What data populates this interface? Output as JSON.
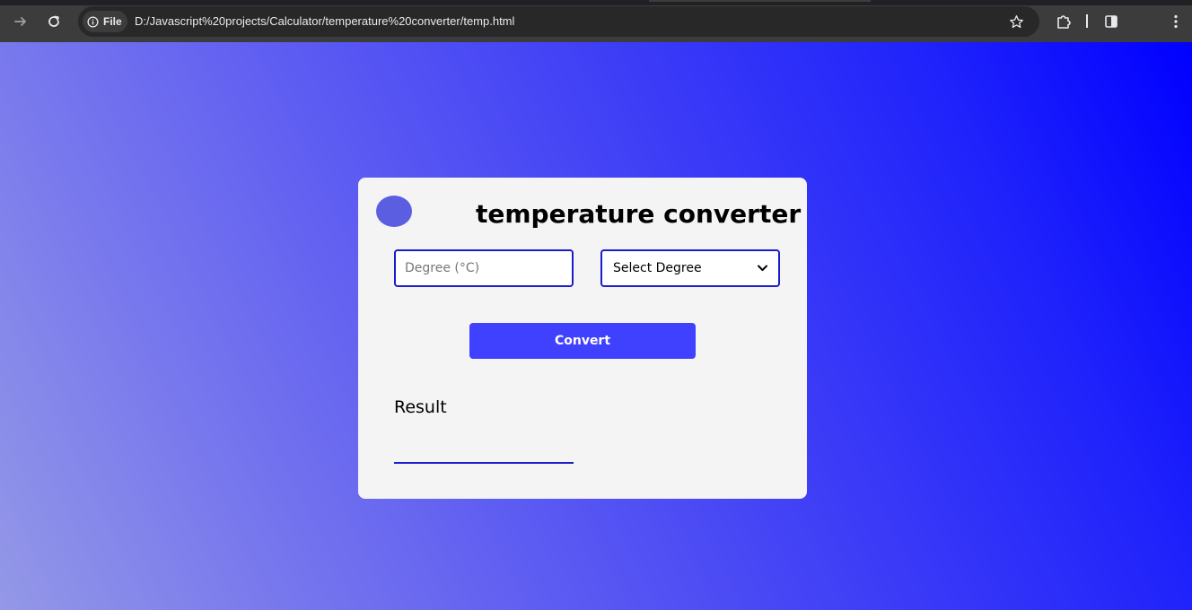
{
  "browser": {
    "site_chip_label": "File",
    "url": "D:/Javascript%20projects/Calculator/temperature%20converter/temp.html",
    "icons": [
      "forward-icon",
      "reload-icon",
      "info-icon",
      "star-icon",
      "extensions-icon",
      "side-panel-icon",
      "menu-icon"
    ]
  },
  "page": {
    "title": "temperature converter",
    "degree_input": {
      "placeholder": "Degree (°C)",
      "value": ""
    },
    "degree_select": {
      "selected": "Select Degree"
    },
    "convert_label": "Convert",
    "result_label": "Result",
    "result_value": ""
  },
  "colors": {
    "card_background": "#f4f4f4",
    "accent": "#4040ff",
    "input_border": "#1c1ccc",
    "toggle": "#5b5ee0",
    "gradient_start": "#9498e6",
    "gradient_end": "#0000ff"
  }
}
